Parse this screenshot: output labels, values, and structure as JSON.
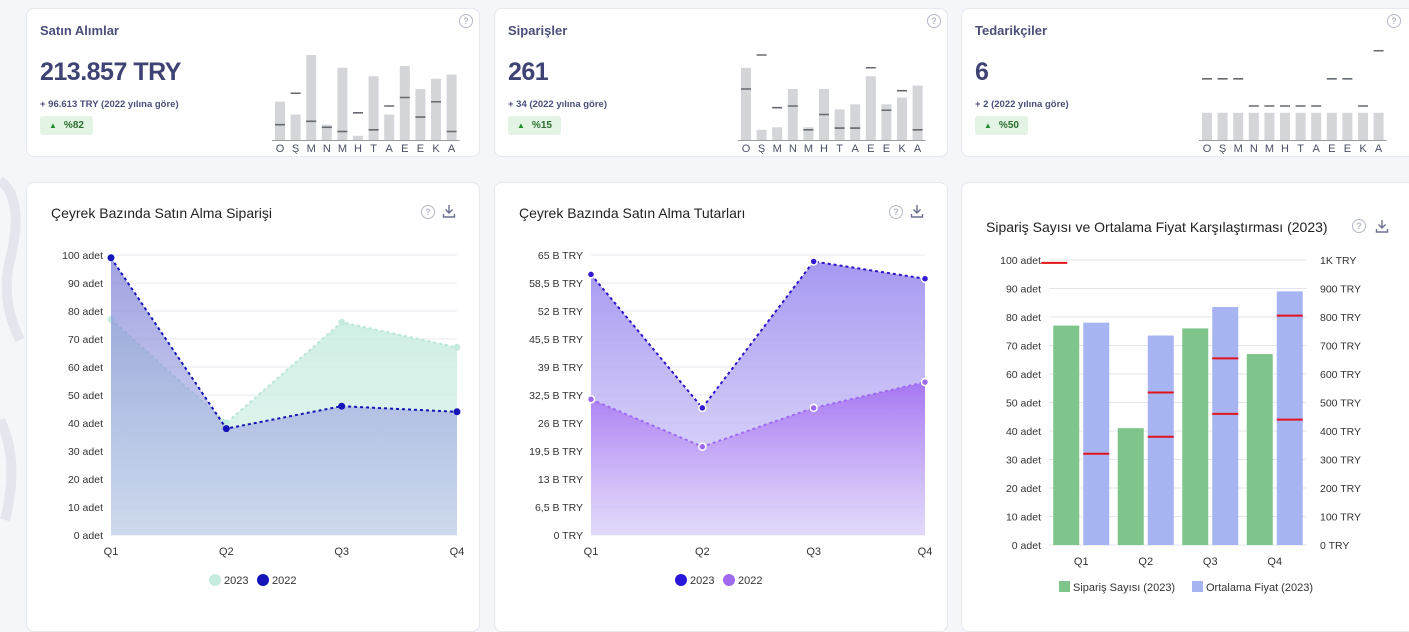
{
  "colors": {
    "green": "#7fc58b",
    "blue_bar": "#a7b4f2",
    "navy": "#1414b8",
    "mint": "#c6ece0",
    "purple": "#a06af0"
  },
  "kpis": [
    {
      "title": "Satın Alımlar",
      "value": "213.857 TRY",
      "sub": "+ 96.613 TRY (2022 yılına göre)",
      "badge": "%82",
      "months": [
        "O",
        "Ş",
        "M",
        "N",
        "M",
        "H",
        "T",
        "A",
        "E",
        "E",
        "K",
        "A"
      ],
      "bars": [
        0.45,
        0.3,
        1.0,
        0.18,
        0.85,
        0.05,
        0.75,
        0.3,
        0.87,
        0.6,
        0.72,
        0.77
      ],
      "marks": [
        0.18,
        0.55,
        0.22,
        0.15,
        0.1,
        0.32,
        0.12,
        0.4,
        0.5,
        0.27,
        0.45,
        0.1
      ]
    },
    {
      "title": "Siparişler",
      "value": "261",
      "sub": "+ 34 (2022 yılına göre)",
      "badge": "%15",
      "months": [
        "O",
        "Ş",
        "M",
        "N",
        "M",
        "H",
        "T",
        "A",
        "E",
        "E",
        "K",
        "A"
      ],
      "bars": [
        0.85,
        0.12,
        0.15,
        0.6,
        0.15,
        0.6,
        0.36,
        0.42,
        0.75,
        0.42,
        0.5,
        0.64
      ],
      "marks": [
        0.6,
        1.0,
        0.38,
        0.4,
        0.12,
        0.3,
        0.14,
        0.14,
        0.85,
        0.35,
        0.58,
        0.12
      ]
    },
    {
      "title": "Tedarikçiler",
      "value": "6",
      "sub": "+ 2 (2022 yılına göre)",
      "badge": "%50",
      "months": [
        "O",
        "Ş",
        "M",
        "N",
        "M",
        "H",
        "T",
        "A",
        "E",
        "E",
        "K",
        "A"
      ],
      "bars": [
        0.32,
        0.32,
        0.32,
        0.32,
        0.32,
        0.32,
        0.32,
        0.32,
        0.32,
        0.32,
        0.32,
        0.32
      ],
      "marks": [
        0.72,
        0.72,
        0.72,
        0.4,
        0.4,
        0.4,
        0.4,
        0.4,
        0.72,
        0.72,
        0.4,
        1.05
      ]
    }
  ],
  "charts": {
    "c1": {
      "title": "Çeyrek Bazında Satın Alma Siparişi"
    },
    "c2": {
      "title": "Çeyrek Bazında Satın Alma Tutarları"
    },
    "c3": {
      "title": "Sipariş Sayısı ve Ortalama Fiyat Karşılaştırması (2023)"
    }
  },
  "chart_data": [
    {
      "type": "area",
      "title": "Çeyrek Bazında Satın Alma Siparişi",
      "categories": [
        "Q1",
        "Q2",
        "Q3",
        "Q4"
      ],
      "yticks": [
        "0 adet",
        "10 adet",
        "20 adet",
        "30 adet",
        "40 adet",
        "50 adet",
        "60 adet",
        "70 adet",
        "80 adet",
        "90 adet",
        "100 adet"
      ],
      "ylim": [
        0,
        100
      ],
      "series": [
        {
          "name": "2023",
          "values": [
            77,
            40,
            76,
            67
          ]
        },
        {
          "name": "2022",
          "values": [
            99,
            38,
            46,
            44
          ]
        }
      ],
      "legend": "bottom"
    },
    {
      "type": "area",
      "title": "Çeyrek Bazında Satın Alma Tutarları",
      "categories": [
        "Q1",
        "Q2",
        "Q3",
        "Q4"
      ],
      "yticks": [
        "0 TRY",
        "6,5 B TRY",
        "13 B TRY",
        "19,5 B TRY",
        "26 B TRY",
        "32,5 B TRY",
        "39 B TRY",
        "45,5 B TRY",
        "52 B TRY",
        "58,5 B TRY",
        "65 B TRY"
      ],
      "ylim": [
        0,
        65
      ],
      "series": [
        {
          "name": "2023",
          "values": [
            60.5,
            29.5,
            63.5,
            59.5
          ]
        },
        {
          "name": "2022",
          "values": [
            31.5,
            20.5,
            29.5,
            35.5
          ]
        }
      ],
      "legend": "bottom"
    },
    {
      "type": "bar",
      "title": "Sipariş Sayısı ve Ortalama Fiyat Karşılaştırması (2023)",
      "categories": [
        "Q1",
        "Q2",
        "Q3",
        "Q4"
      ],
      "yticks_left": [
        "0 adet",
        "10 adet",
        "20 adet",
        "30 adet",
        "40 adet",
        "50 adet",
        "60 adet",
        "70 adet",
        "80 adet",
        "90 adet",
        "100 adet"
      ],
      "yticks_right": [
        "0 TRY",
        "100 TRY",
        "200 TRY",
        "300 TRY",
        "400 TRY",
        "500 TRY",
        "600 TRY",
        "700 TRY",
        "800 TRY",
        "900 TRY",
        "1K TRY"
      ],
      "ylim_left": [
        0,
        100
      ],
      "ylim_right": [
        0,
        1000
      ],
      "series": [
        {
          "name": "Sipariş Sayısı (2023)",
          "values": [
            77,
            41,
            76,
            67
          ],
          "axis": "left"
        },
        {
          "name": "Ortalama Fiyat (2023)",
          "values": [
            780,
            735,
            835,
            890
          ],
          "axis": "right"
        }
      ],
      "markers_left": [
        32,
        38,
        46,
        44
      ],
      "markers_right": [
        990,
        535,
        655,
        805
      ],
      "legend": "bottom"
    }
  ]
}
